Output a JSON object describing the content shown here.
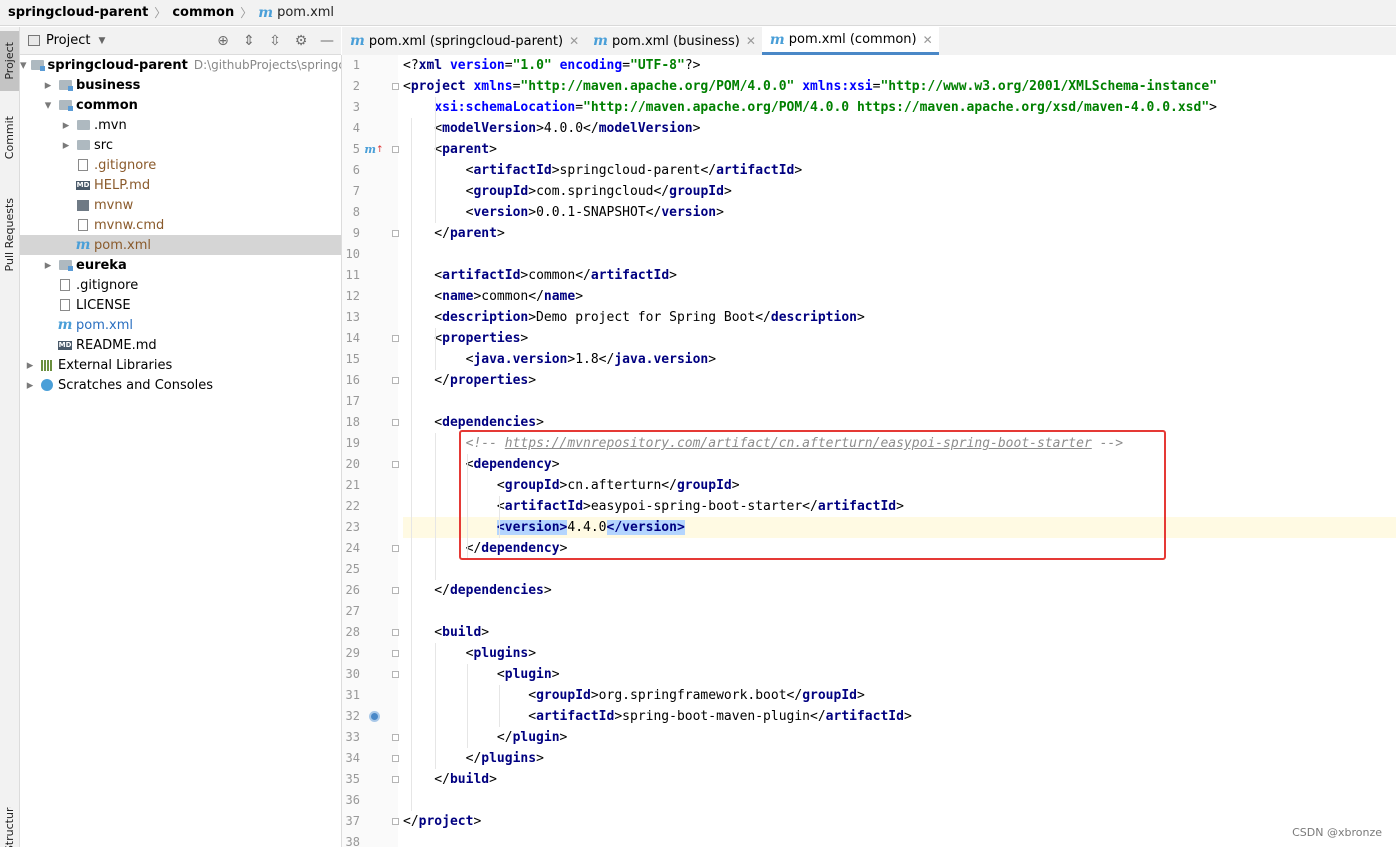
{
  "breadcrumb": [
    "springcloud-parent",
    "common",
    "pom.xml"
  ],
  "side_tabs": [
    "Project",
    "Commit",
    "Pull Requests",
    "Structure"
  ],
  "project_panel": {
    "title": "Project",
    "tree": [
      {
        "label": "springcloud-parent",
        "path": "D:\\githubProjects\\springclo",
        "icon": "module-folder-icon",
        "bold": true,
        "expanded": true,
        "depth": 0
      },
      {
        "label": "business",
        "icon": "module-folder-icon",
        "bold": true,
        "expanded": false,
        "depth": 1
      },
      {
        "label": "common",
        "icon": "module-folder-icon",
        "bold": true,
        "expanded": true,
        "depth": 1
      },
      {
        "label": ".mvn",
        "icon": "folder-icon",
        "expanded": false,
        "depth": 2
      },
      {
        "label": "src",
        "icon": "folder-icon",
        "expanded": false,
        "depth": 2
      },
      {
        "label": ".gitignore",
        "icon": "file-icon",
        "color": "brown",
        "depth": 2
      },
      {
        "label": "HELP.md",
        "icon": "markdown-icon",
        "color": "brown",
        "depth": 2
      },
      {
        "label": "mvnw",
        "icon": "terminal-icon",
        "color": "brown",
        "depth": 2
      },
      {
        "label": "mvnw.cmd",
        "icon": "file-icon",
        "color": "brown",
        "depth": 2
      },
      {
        "label": "pom.xml",
        "icon": "maven-icon",
        "color": "brown",
        "depth": 2,
        "selected": true
      },
      {
        "label": "eureka",
        "icon": "module-folder-icon",
        "bold": true,
        "expanded": false,
        "depth": 1
      },
      {
        "label": ".gitignore",
        "icon": "file-icon",
        "depth": 1
      },
      {
        "label": "LICENSE",
        "icon": "file-icon",
        "depth": 1
      },
      {
        "label": "pom.xml",
        "icon": "maven-icon",
        "color": "blue",
        "depth": 1
      },
      {
        "label": "README.md",
        "icon": "markdown-icon",
        "depth": 1
      },
      {
        "label": "External Libraries",
        "icon": "libraries-icon",
        "expanded": false,
        "depth": 0
      },
      {
        "label": "Scratches and Consoles",
        "icon": "scratches-icon",
        "expanded": false,
        "depth": 0
      }
    ]
  },
  "editor_tabs": [
    {
      "label": "pom.xml (springcloud-parent)",
      "active": false
    },
    {
      "label": "pom.xml (business)",
      "active": false
    },
    {
      "label": "pom.xml (common)",
      "active": true
    }
  ],
  "editor": {
    "current_line": 23,
    "lines": [
      [
        [
          "br",
          "<?"
        ],
        [
          "tag",
          "xml "
        ],
        [
          "attr",
          "version"
        ],
        [
          "br",
          "="
        ],
        [
          "val",
          "\"1.0\" "
        ],
        [
          "attr",
          "encoding"
        ],
        [
          "br",
          "="
        ],
        [
          "val",
          "\"UTF-8\""
        ],
        [
          "br",
          "?>"
        ]
      ],
      [
        [
          "br",
          "<"
        ],
        [
          "tag",
          "project "
        ],
        [
          "attr",
          "xmlns"
        ],
        [
          "br",
          "="
        ],
        [
          "val",
          "\"http://maven.apache.org/POM/4.0.0\" "
        ],
        [
          "attr",
          "xmlns:xsi"
        ],
        [
          "br",
          "="
        ],
        [
          "val",
          "\"http://www.w3.org/2001/XMLSchema-instance\""
        ]
      ],
      [
        [
          "br",
          "    "
        ],
        [
          "attr",
          "xsi:schemaLocation"
        ],
        [
          "br",
          "="
        ],
        [
          "val",
          "\"http://maven.apache.org/POM/4.0.0 https://maven.apache.org/xsd/maven-4.0.0.xsd\""
        ],
        [
          "br",
          ">"
        ]
      ],
      [
        [
          "br",
          "    <"
        ],
        [
          "tag",
          "modelVersion"
        ],
        [
          "br",
          ">4.0.0</"
        ],
        [
          "tag",
          "modelVersion"
        ],
        [
          "br",
          ">"
        ]
      ],
      [
        [
          "br",
          "    <"
        ],
        [
          "tag",
          "parent"
        ],
        [
          "br",
          ">"
        ]
      ],
      [
        [
          "br",
          "        <"
        ],
        [
          "tag",
          "artifactId"
        ],
        [
          "br",
          ">springcloud-parent</"
        ],
        [
          "tag",
          "artifactId"
        ],
        [
          "br",
          ">"
        ]
      ],
      [
        [
          "br",
          "        <"
        ],
        [
          "tag",
          "groupId"
        ],
        [
          "br",
          ">com.springcloud</"
        ],
        [
          "tag",
          "groupId"
        ],
        [
          "br",
          ">"
        ]
      ],
      [
        [
          "br",
          "        <"
        ],
        [
          "tag",
          "version"
        ],
        [
          "br",
          ">0.0.1-SNAPSHOT</"
        ],
        [
          "tag",
          "version"
        ],
        [
          "br",
          ">"
        ]
      ],
      [
        [
          "br",
          "    </"
        ],
        [
          "tag",
          "parent"
        ],
        [
          "br",
          ">"
        ]
      ],
      [],
      [
        [
          "br",
          "    <"
        ],
        [
          "tag",
          "artifactId"
        ],
        [
          "br",
          ">common</"
        ],
        [
          "tag",
          "artifactId"
        ],
        [
          "br",
          ">"
        ]
      ],
      [
        [
          "br",
          "    <"
        ],
        [
          "tag",
          "name"
        ],
        [
          "br",
          ">common</"
        ],
        [
          "tag",
          "name"
        ],
        [
          "br",
          ">"
        ]
      ],
      [
        [
          "br",
          "    <"
        ],
        [
          "tag",
          "description"
        ],
        [
          "br",
          ">Demo project for Spring Boot</"
        ],
        [
          "tag",
          "description"
        ],
        [
          "br",
          ">"
        ]
      ],
      [
        [
          "br",
          "    <"
        ],
        [
          "tag",
          "properties"
        ],
        [
          "br",
          ">"
        ]
      ],
      [
        [
          "br",
          "        <"
        ],
        [
          "tag",
          "java.version"
        ],
        [
          "br",
          ">1.8</"
        ],
        [
          "tag",
          "java.version"
        ],
        [
          "br",
          ">"
        ]
      ],
      [
        [
          "br",
          "    </"
        ],
        [
          "tag",
          "properties"
        ],
        [
          "br",
          ">"
        ]
      ],
      [],
      [
        [
          "br",
          "    <"
        ],
        [
          "tag",
          "dependencies"
        ],
        [
          "br",
          ">"
        ]
      ],
      [
        [
          "br",
          "        "
        ],
        [
          "cmt",
          "<!-- "
        ],
        [
          "cmtlink",
          "https://mvnrepository.com/artifact/cn.afterturn/easypoi-spring-boot-starter"
        ],
        [
          "cmt",
          " -->"
        ]
      ],
      [
        [
          "br",
          "        <"
        ],
        [
          "tag",
          "dependency"
        ],
        [
          "br",
          ">"
        ]
      ],
      [
        [
          "br",
          "            <"
        ],
        [
          "tag",
          "groupId"
        ],
        [
          "br",
          ">cn.afterturn</"
        ],
        [
          "tag",
          "groupId"
        ],
        [
          "br",
          ">"
        ]
      ],
      [
        [
          "br",
          "            <"
        ],
        [
          "tag",
          "artifactId"
        ],
        [
          "br",
          ">easypoi-spring-boot-starter</"
        ],
        [
          "tag",
          "artifactId"
        ],
        [
          "br",
          ">"
        ]
      ],
      [
        [
          "br",
          "            "
        ],
        [
          "hltag",
          "<version>"
        ],
        [
          "br",
          "4.4.0"
        ],
        [
          "hltag",
          "</version>"
        ]
      ],
      [
        [
          "br",
          "        </"
        ],
        [
          "tag",
          "dependency"
        ],
        [
          "br",
          ">"
        ]
      ],
      [],
      [
        [
          "br",
          "    </"
        ],
        [
          "tag",
          "dependencies"
        ],
        [
          "br",
          ">"
        ]
      ],
      [],
      [
        [
          "br",
          "    <"
        ],
        [
          "tag",
          "build"
        ],
        [
          "br",
          ">"
        ]
      ],
      [
        [
          "br",
          "        <"
        ],
        [
          "tag",
          "plugins"
        ],
        [
          "br",
          ">"
        ]
      ],
      [
        [
          "br",
          "            <"
        ],
        [
          "tag",
          "plugin"
        ],
        [
          "br",
          ">"
        ]
      ],
      [
        [
          "br",
          "                <"
        ],
        [
          "tag",
          "groupId"
        ],
        [
          "br",
          ">org.springframework.boot</"
        ],
        [
          "tag",
          "groupId"
        ],
        [
          "br",
          ">"
        ]
      ],
      [
        [
          "br",
          "                <"
        ],
        [
          "tag",
          "artifactId"
        ],
        [
          "br",
          ">spring-boot-maven-plugin</"
        ],
        [
          "tag",
          "artifactId"
        ],
        [
          "br",
          ">"
        ]
      ],
      [
        [
          "br",
          "            </"
        ],
        [
          "tag",
          "plugin"
        ],
        [
          "br",
          ">"
        ]
      ],
      [
        [
          "br",
          "        </"
        ],
        [
          "tag",
          "plugins"
        ],
        [
          "br",
          ">"
        ]
      ],
      [
        [
          "br",
          "    </"
        ],
        [
          "tag",
          "build"
        ],
        [
          "br",
          ">"
        ]
      ],
      [],
      [
        [
          "br",
          "</"
        ],
        [
          "tag",
          "project"
        ],
        [
          "br",
          ">"
        ]
      ],
      []
    ]
  },
  "watermark": "CSDN @xbronze"
}
